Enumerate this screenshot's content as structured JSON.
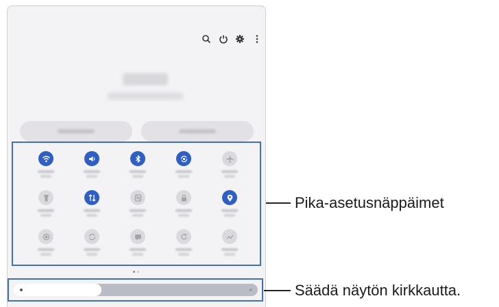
{
  "toolbar": {
    "icons": [
      "search-icon",
      "power-icon",
      "settings-icon",
      "more-options-icon"
    ]
  },
  "quick_settings": {
    "rows": [
      [
        {
          "icon": "wifi-icon",
          "state": "on"
        },
        {
          "icon": "sound-icon",
          "state": "on"
        },
        {
          "icon": "bluetooth-icon",
          "state": "on"
        },
        {
          "icon": "auto-rotate-icon",
          "state": "on"
        },
        {
          "icon": "airplane-icon",
          "state": "off"
        }
      ],
      [
        {
          "icon": "flashlight-icon",
          "state": "off"
        },
        {
          "icon": "mobile-data-icon",
          "state": "on"
        },
        {
          "icon": "nfc-icon",
          "state": "off"
        },
        {
          "icon": "lock-icon",
          "state": "off"
        },
        {
          "icon": "location-icon",
          "state": "on"
        }
      ],
      [
        {
          "icon": "screen-record-icon",
          "state": "off"
        },
        {
          "icon": "sync-icon",
          "state": "off"
        },
        {
          "icon": "message-icon",
          "state": "off"
        },
        {
          "icon": "refresh-icon",
          "state": "off"
        },
        {
          "icon": "share-icon",
          "state": "off"
        }
      ]
    ],
    "page_count": 2,
    "current_page": 1
  },
  "brightness": {
    "level": 0.36
  },
  "callouts": {
    "quick_buttons": "Pika-asetusnäppäimet",
    "brightness": "Säädä näytön kirkkautta."
  },
  "colors": {
    "accent": "#2f5fc4",
    "highlight_border": "#3f6fb6"
  }
}
